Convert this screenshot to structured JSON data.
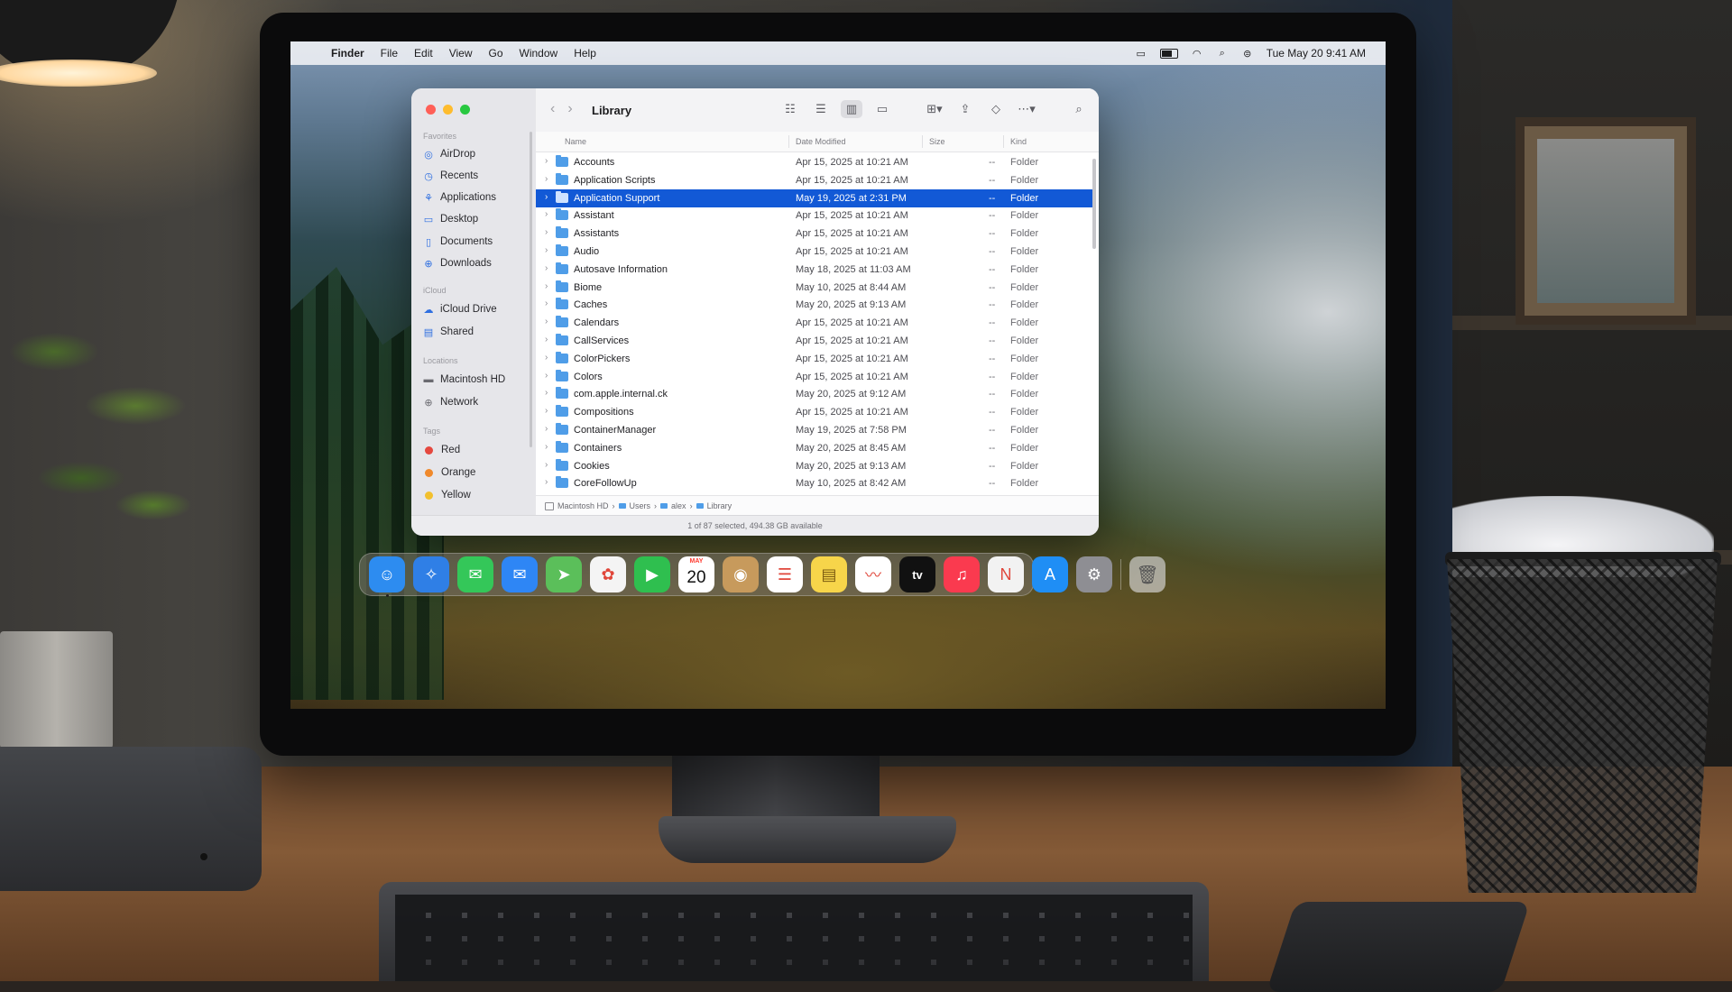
{
  "menubar": {
    "app_name": "Finder",
    "menus": [
      "File",
      "Edit",
      "View",
      "Go",
      "Window",
      "Help"
    ],
    "clock": "Tue May 20  9:41 AM"
  },
  "window": {
    "title": "Library",
    "sidebar": {
      "favorites_header": "Favorites",
      "favorites": [
        {
          "label": "AirDrop",
          "icon": "airdrop-icon"
        },
        {
          "label": "Recents",
          "icon": "clock-icon"
        },
        {
          "label": "Applications",
          "icon": "applications-icon"
        },
        {
          "label": "Desktop",
          "icon": "desktop-icon"
        },
        {
          "label": "Documents",
          "icon": "document-icon"
        },
        {
          "label": "Downloads",
          "icon": "download-icon"
        }
      ],
      "icloud_header": "iCloud",
      "icloud": [
        {
          "label": "iCloud Drive",
          "icon": "cloud-icon"
        },
        {
          "label": "Shared",
          "icon": "shared-folder-icon"
        }
      ],
      "locations_header": "Locations",
      "locations": [
        {
          "label": "Macintosh HD",
          "icon": "hard-drive-icon"
        },
        {
          "label": "Network",
          "icon": "globe-icon"
        }
      ],
      "tags_header": "Tags",
      "tags": [
        {
          "label": "Red",
          "color": "#e5483f"
        },
        {
          "label": "Orange",
          "color": "#f0892b"
        },
        {
          "label": "Yellow",
          "color": "#f2c02e"
        }
      ]
    },
    "columns": {
      "name": "Name",
      "date": "Date Modified",
      "size": "Size",
      "kind": "Kind"
    },
    "rows": [
      {
        "name": "Accounts",
        "date": "Apr 15, 2025 at 10:21 AM",
        "size": "--",
        "kind": "Folder"
      },
      {
        "name": "Application Scripts",
        "date": "Apr 15, 2025 at 10:21 AM",
        "size": "--",
        "kind": "Folder"
      },
      {
        "name": "Application Support",
        "date": "May 19, 2025 at 2:31 PM",
        "size": "--",
        "kind": "Folder",
        "selected": true
      },
      {
        "name": "Assistant",
        "date": "Apr 15, 2025 at 10:21 AM",
        "size": "--",
        "kind": "Folder"
      },
      {
        "name": "Assistants",
        "date": "Apr 15, 2025 at 10:21 AM",
        "size": "--",
        "kind": "Folder"
      },
      {
        "name": "Audio",
        "date": "Apr 15, 2025 at 10:21 AM",
        "size": "--",
        "kind": "Folder"
      },
      {
        "name": "Autosave Information",
        "date": "May 18, 2025 at 11:03 AM",
        "size": "--",
        "kind": "Folder"
      },
      {
        "name": "Biome",
        "date": "May 10, 2025 at 8:44 AM",
        "size": "--",
        "kind": "Folder"
      },
      {
        "name": "Caches",
        "date": "May 20, 2025 at 9:13 AM",
        "size": "--",
        "kind": "Folder"
      },
      {
        "name": "Calendars",
        "date": "Apr 15, 2025 at 10:21 AM",
        "size": "--",
        "kind": "Folder"
      },
      {
        "name": "CallServices",
        "date": "Apr 15, 2025 at 10:21 AM",
        "size": "--",
        "kind": "Folder"
      },
      {
        "name": "ColorPickers",
        "date": "Apr 15, 2025 at 10:21 AM",
        "size": "--",
        "kind": "Folder"
      },
      {
        "name": "Colors",
        "date": "Apr 15, 2025 at 10:21 AM",
        "size": "--",
        "kind": "Folder"
      },
      {
        "name": "com.apple.internal.ck",
        "date": "May 20, 2025 at 9:12 AM",
        "size": "--",
        "kind": "Folder"
      },
      {
        "name": "Compositions",
        "date": "Apr 15, 2025 at 10:21 AM",
        "size": "--",
        "kind": "Folder"
      },
      {
        "name": "ContainerManager",
        "date": "May 19, 2025 at 7:58 PM",
        "size": "--",
        "kind": "Folder"
      },
      {
        "name": "Containers",
        "date": "May 20, 2025 at 8:45 AM",
        "size": "--",
        "kind": "Folder"
      },
      {
        "name": "Cookies",
        "date": "May 20, 2025 at 9:13 AM",
        "size": "--",
        "kind": "Folder"
      },
      {
        "name": "CoreFollowUp",
        "date": "May 10, 2025 at 8:42 AM",
        "size": "--",
        "kind": "Folder"
      }
    ],
    "path": [
      "Macintosh HD",
      "Users",
      "alex",
      "Library"
    ],
    "status": "1 of 87 selected, 494.38 GB available"
  },
  "dock": {
    "calendar_month": "MAY",
    "calendar_day": "20",
    "tv_label": "tv",
    "apps": [
      {
        "icon": "finder-icon",
        "color": "#2d8cf0"
      },
      {
        "icon": "safari-icon",
        "color": "#2f7fe6"
      },
      {
        "icon": "messages-icon",
        "color": "#34c759"
      },
      {
        "icon": "mail-icon",
        "color": "#2e86f5"
      },
      {
        "icon": "maps-icon",
        "color": "#5bbf5a"
      },
      {
        "icon": "photos-icon",
        "color": "#f4f4f4"
      },
      {
        "icon": "facetime-icon",
        "color": "#2fbf4f"
      },
      {
        "icon": "calendar-icon",
        "color": "#ffffff"
      },
      {
        "icon": "contacts-icon",
        "color": "#c79a5c"
      },
      {
        "icon": "reminders-icon",
        "color": "#ffffff"
      },
      {
        "icon": "notes-icon",
        "color": "#f7d54a"
      },
      {
        "icon": "freeform-icon",
        "color": "#ffffff"
      },
      {
        "icon": "apple-tv-icon",
        "color": "#111111"
      },
      {
        "icon": "music-icon",
        "color": "#fa3a4f"
      },
      {
        "icon": "news-icon",
        "color": "#f2f2f2"
      },
      {
        "icon": "app-store-icon",
        "color": "#1f8ef5"
      },
      {
        "icon": "system-settings-icon",
        "color": "#8e8e93"
      }
    ],
    "trash_icon": "trash-icon"
  }
}
